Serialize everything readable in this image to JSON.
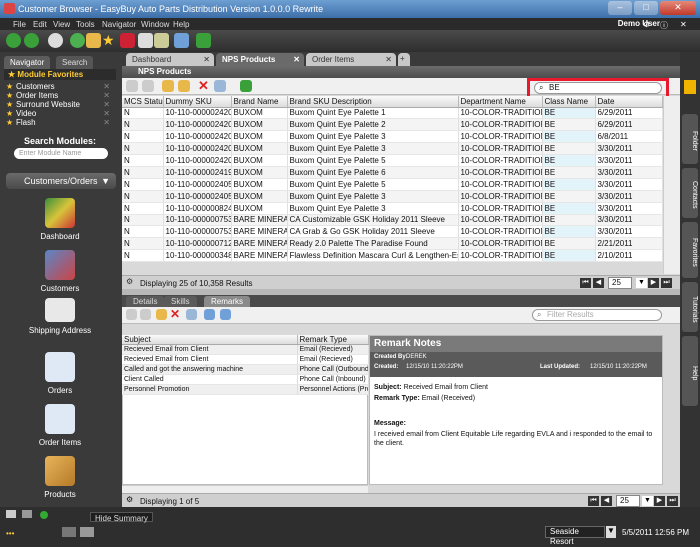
{
  "window": {
    "title": "Customer Browser - EasyBuy Auto Parts Distribution Version 1.0.0.0 Rewrite",
    "user": "Demo User"
  },
  "menu": [
    "File",
    "Edit",
    "View",
    "Tools",
    "Navigator",
    "Window",
    "Help"
  ],
  "sidebar": {
    "tabs": [
      "Navigator",
      "Search"
    ],
    "favorites_title": "Module Favorites",
    "favorites": [
      "Customers",
      "Order Items",
      "Surround Website",
      "Video",
      "Flash"
    ],
    "search_label": "Search Modules:",
    "search_placeholder": "Enter Module Name",
    "category": "Customers/Orders",
    "modules": [
      "Dashboard",
      "Customers",
      "Shipping Address",
      "Orders",
      "Order Items",
      "Products"
    ]
  },
  "doc_tabs": [
    "Dashboard",
    "NPS Products",
    "Order Items"
  ],
  "panel_title": "NPS Products",
  "grid": {
    "search_value": "BE",
    "columns": [
      "MCS Status",
      "Dummy SKU",
      "Brand Name",
      "Brand SKU Description",
      "Department Name",
      "Class Name",
      "Date"
    ],
    "rows": [
      [
        "N",
        "10-110-0000024204",
        "BUXOM",
        "Buxom Quint Eye Palette 1",
        "10-COLOR-TRADITIONAL",
        "BE",
        "6/29/2011"
      ],
      [
        "N",
        "10-110-0000024203",
        "BUXOM",
        "Buxom Quint Eye Palette 2",
        "10-COLOR-TRADITIONAL",
        "BE",
        "6/29/2011"
      ],
      [
        "N",
        "10-110-0000024202",
        "BUXOM",
        "Buxom Quint Eye Palette 3",
        "10-COLOR-TRADITIONAL",
        "BE",
        "6/8/2011"
      ],
      [
        "N",
        "10-110-0000024202",
        "BUXOM",
        "Buxom Quint Eye Palette 3",
        "10-COLOR-TRADITIONAL",
        "BE",
        "3/30/2011"
      ],
      [
        "N",
        "10-110-0000024200",
        "BUXOM",
        "Buxom Quint Eye Palette 5",
        "10-COLOR-TRADITIONAL",
        "BE",
        "3/30/2011"
      ],
      [
        "N",
        "10-110-0000024199",
        "BUXOM",
        "Buxom Quint Eye Palette 6",
        "10-COLOR-TRADITIONAL",
        "BE",
        "3/30/2011"
      ],
      [
        "N",
        "10-110-0000024057",
        "BUXOM",
        "Buxom Quint Eye Palette 5",
        "10-COLOR-TRADITIONAL",
        "BE",
        "3/30/2011"
      ],
      [
        "N",
        "10-110-0000024056",
        "BUXOM",
        "Buxom Quint Eye Palette 3",
        "10-COLOR-TRADITIONAL",
        "BE",
        "3/30/2011"
      ],
      [
        "N",
        "10-110-0000008240",
        "BUXOM",
        "Buxom Quint Eye Palette 3",
        "10-COLOR-TRADITIONAL",
        "BE",
        "3/30/2011"
      ],
      [
        "N",
        "10-110-0000007535",
        "BARE MINERALS",
        "CA Customizable GSK Holiday 2011 Sleeve",
        "10-COLOR-TRADITIONAL",
        "BE",
        "3/30/2011"
      ],
      [
        "N",
        "10-110-0000007534",
        "BARE MINERALS",
        "CA Grab & Go GSK Holiday 2011 Sleeve",
        "10-COLOR-TRADITIONAL",
        "BE",
        "3/30/2011"
      ],
      [
        "N",
        "10-110-0000007122",
        "BARE MINERALS",
        "Ready 2.0 Palette The Paradise Found",
        "10-COLOR-TRADITIONAL",
        "BE",
        "2/21/2011"
      ],
      [
        "N",
        "10-110-0000003480",
        "BARE MINERALS",
        "Flawless Definition Mascara Curl & Lengthen-Espresso",
        "10-COLOR-TRADITIONAL",
        "BE",
        "2/10/2011"
      ]
    ],
    "status": "Displaying 25 of 10,358 Results",
    "page_size": "25"
  },
  "bottom": {
    "tabs": [
      "Details",
      "Skills",
      "Remarks"
    ],
    "filter_placeholder": "Filter Results",
    "columns": [
      "Subject",
      "Remark Type"
    ],
    "rows": [
      [
        "Recieved Email from Client",
        "Email (Recieved)"
      ],
      [
        "Recieved Email from Client",
        "Email (Recieved)"
      ],
      [
        "Called and got the answering machine",
        "Phone Call (Outbound)"
      ],
      [
        "Client Called",
        "Phone Call (Inbound)"
      ],
      [
        "Personnel Promotion",
        "Personnel Actions (Prom"
      ]
    ],
    "status": "Displaying 1 of 5",
    "page_size": "25",
    "notes": {
      "title": "Remark Notes",
      "created_by_label": "Created By:",
      "created_by": "DEREK",
      "created_label": "Created:",
      "created": "12/15/10  11:20:22PM",
      "updated_label": "Last Updated:",
      "updated": "12/15/10  11:20:22PM",
      "subject_label": "Subject:",
      "subject": "Received Email from Client",
      "type_label": "Remark Type:",
      "type": "Email (Received)",
      "message_label": "Message:",
      "message": "I received email from Client Equitable Life regarding EVLA and i responded to the email to the client."
    }
  },
  "right_rail": [
    "Folder",
    "Contacts",
    "Favorites",
    "Tutorials",
    "Help"
  ],
  "statusbar": {
    "tooltip": "Hide Summary",
    "location": "Seaside Resort",
    "datetime": "5/5/2011   12:56 PM"
  }
}
